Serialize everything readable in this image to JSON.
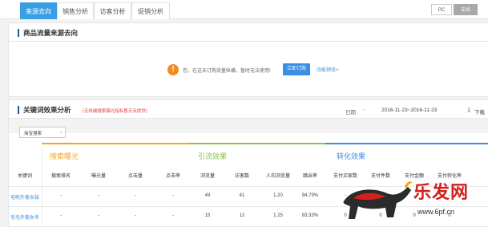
{
  "tabs": [
    {
      "label": "来源去向",
      "active": true
    },
    {
      "label": "销售分析",
      "active": false
    },
    {
      "label": "访客分析",
      "active": false
    },
    {
      "label": "促销分析",
      "active": false
    }
  ],
  "device_toggle": {
    "pc": "PC",
    "wireless": "无线",
    "selected": "无线"
  },
  "traffic_section": {
    "title": "商品流量来源去向",
    "notice": "您，在这未订购流量纵横，暂时无法使用!",
    "order_button": "立即订购",
    "intro_link": "功能预览>"
  },
  "keyword_section": {
    "title": "关键词效果分析",
    "note": "(无线端搜索曝光指标暂无法提供)",
    "date_label": "日期",
    "date_range": "2016-11-23~2016-11-23",
    "download_label": "下载",
    "filter_value": "淘宝搜索"
  },
  "groups": [
    {
      "label": "搜索曝光",
      "color": "#f5a623"
    },
    {
      "label": "引流效果",
      "color": "#8bc34a"
    },
    {
      "label": "转化效果",
      "color": "#3a8ee6"
    }
  ],
  "columns": [
    "关键词",
    "搜索排名",
    "曝光量",
    "点击量",
    "点击率",
    "浏览量",
    "访客数",
    "人均浏览量",
    "跳出率",
    "支付买家数",
    "支付件数",
    "支付金额",
    "支付转化率"
  ],
  "rows": [
    {
      "keyword": "毛呢外套女装",
      "cells": [
        "-",
        "-",
        "-",
        "-",
        "49",
        "41",
        "1.20",
        "94.79%",
        "-",
        "-",
        "-",
        "-"
      ]
    },
    {
      "keyword": "毛毛外套女冬",
      "cells": [
        "-",
        "-",
        "-",
        "-",
        "15",
        "12",
        "1.25",
        "83.33%",
        "0",
        "0",
        "0",
        "0"
      ]
    }
  ],
  "watermark": {
    "text": "乐发网",
    "url": "www.6pf.cn"
  },
  "colors": {
    "accent": "#3a9ee5",
    "warning": "#f38b1e",
    "note_red": "#e34444",
    "title_bar": "#1a5aa8"
  }
}
